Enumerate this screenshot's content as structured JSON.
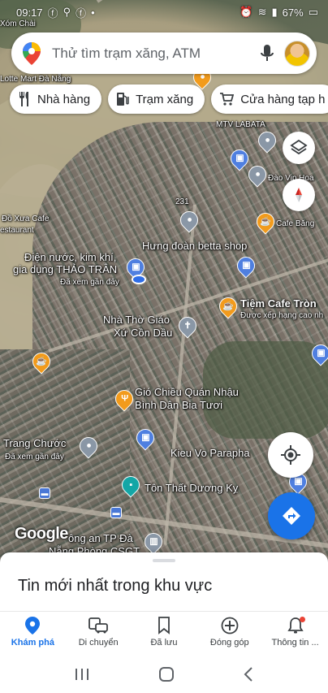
{
  "status_bar": {
    "time": "09:17",
    "battery": "67%"
  },
  "search": {
    "placeholder": "Thử tìm trạm xăng, ATM"
  },
  "chips": [
    {
      "label": "Nhà hàng",
      "icon": "restaurant-icon"
    },
    {
      "label": "Trạm xăng",
      "icon": "gas-station-icon"
    },
    {
      "label": "Cửa hàng tạp h",
      "icon": "cart-icon"
    }
  ],
  "map": {
    "labels": {
      "xom_chai": "Xóm Chài",
      "lotte": "Lotte Mart Đà Nẵng",
      "mtv_labata": "MTV LABATA",
      "dao_vip": "Đào Vip Hoa",
      "road_231": "231",
      "cafe_bang": "Cafe Băng",
      "do_xua_cafe": "Đồ Xưa Cafe",
      "restaurant": "estaurant",
      "hung_doan": "Hưng đoàn betta shop",
      "dien_nuoc_1": "Điện nước, kim khí,",
      "dien_nuoc_2": "gia dụng THẢO TRÂN",
      "da_xem_1": "Đã xem gần đây",
      "tiem_cafe": "Tiệm Cafe Tròn",
      "tiem_cafe_sub": "Được xếp hạng cao nh",
      "nha_tho_1": "Nhà Thờ Giáo",
      "nha_tho_2": "Xứ Cồn Dầu",
      "gio_chieu_1": "Gió Chiều Quán Nhậu",
      "gio_chieu_2": "Bình Dân Bia Tươi",
      "trang_chuoc": "Trang Chước",
      "da_xem_2": "Đã xem gần đây",
      "kieu_vo": "Kieu Vo Parapha",
      "ton_that": "Tôn Thất Dương Kỵ",
      "cong_an": "ông an TP Đà",
      "phong": "Nẵng Phòng CSGT",
      "google": "Google"
    }
  },
  "sheet": {
    "title": "Tin mới nhất trong khu vực"
  },
  "bottom_nav": [
    {
      "label": "Khám phá",
      "icon": "explore-pin-icon",
      "active": true
    },
    {
      "label": "Di chuyển",
      "icon": "commute-icon",
      "active": false
    },
    {
      "label": "Đã lưu",
      "icon": "bookmark-icon",
      "active": false
    },
    {
      "label": "Đóng góp",
      "icon": "add-circle-icon",
      "active": false
    },
    {
      "label": "Thông tin ...",
      "icon": "bell-icon",
      "active": false
    }
  ],
  "colors": {
    "accent": "#1a73e8",
    "notification": "#ea4335"
  }
}
